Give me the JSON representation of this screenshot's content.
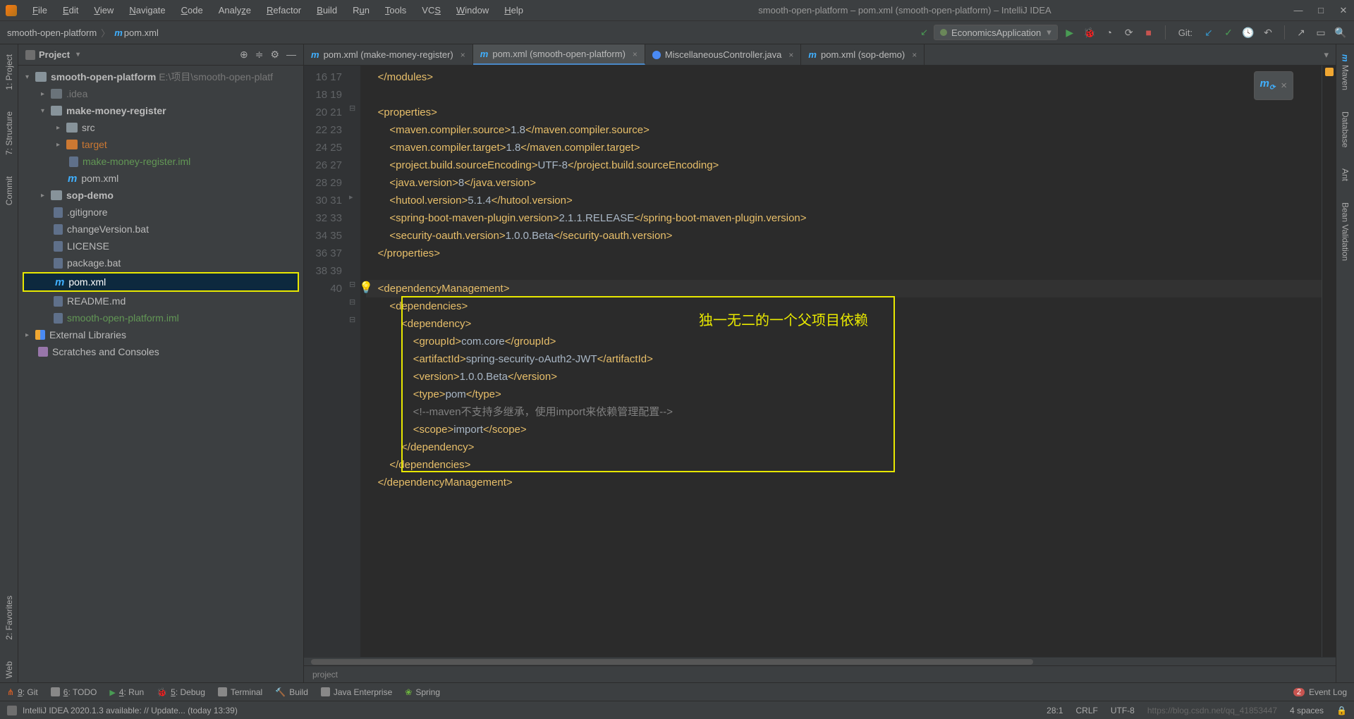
{
  "window": {
    "title": "smooth-open-platform – pom.xml (smooth-open-platform) – IntelliJ IDEA",
    "min_icon": "—",
    "max_icon": "□",
    "close_icon": "✕"
  },
  "menu": [
    "File",
    "Edit",
    "View",
    "Navigate",
    "Code",
    "Analyze",
    "Refactor",
    "Build",
    "Run",
    "Tools",
    "VCS",
    "Window",
    "Help"
  ],
  "breadcrumb": {
    "project": "smooth-open-platform",
    "file": "pom.xml"
  },
  "run_config": {
    "name": "EconomicsApplication"
  },
  "git_label": "Git:",
  "left_gutter": [
    "1: Project",
    "7: Structure",
    "Commit",
    "2: Favorites",
    "Web"
  ],
  "right_gutter": [
    "Maven",
    "Database",
    "Ant",
    "Bean Validation"
  ],
  "project_panel": {
    "title": "Project",
    "tree": {
      "root": {
        "name": "smooth-open-platform",
        "path": "E:\\项目\\smooth-open-platf"
      },
      "idea": ".idea",
      "mmr": "make-money-register",
      "src": "src",
      "target": "target",
      "mmr_iml": "make-money-register.iml",
      "mmr_pom": "pom.xml",
      "sop": "sop-demo",
      "gitignore": ".gitignore",
      "changeVersion": "changeVersion.bat",
      "license": "LICENSE",
      "package": "package.bat",
      "root_pom": "pom.xml",
      "readme": "README.md",
      "root_iml": "smooth-open-platform.iml",
      "ext": "External Libraries",
      "scratch": "Scratches and Consoles"
    }
  },
  "tabs": [
    {
      "label": "pom.xml (make-money-register)",
      "icon": "m",
      "active": false
    },
    {
      "label": "pom.xml (smooth-open-platform)",
      "icon": "m",
      "active": true
    },
    {
      "label": "MiscellaneousController.java",
      "icon": "j",
      "active": false
    },
    {
      "label": "pom.xml (sop-demo)",
      "icon": "m",
      "active": false
    }
  ],
  "editor": {
    "line_start": 16,
    "line_end": 40,
    "annotation": "独一无二的一个父项目依赖",
    "lines": {
      "16": "    </modules>",
      "17": "",
      "18": "    <properties>",
      "19": "        <maven.compiler.source>1.8</maven.compiler.source>",
      "20": "        <maven.compiler.target>1.8</maven.compiler.target>",
      "21": "        <project.build.sourceEncoding>UTF-8</project.build.sourceEncoding>",
      "22": "        <java.version>8</java.version>",
      "23": "        <hutool.version>5.1.4</hutool.version>",
      "24": "        <spring-boot-maven-plugin.version>2.1.1.RELEASE</spring-boot-maven-plugin.version>",
      "25": "        <security-oauth.version>1.0.0.Beta</security-oauth.version>",
      "26": "    </properties>",
      "27": "",
      "28": "    <dependencyManagement>",
      "29": "        <dependencies>",
      "30": "            <dependency>",
      "31": "                <groupId>com.core</groupId>",
      "32": "                <artifactId>spring-security-oAuth2-JWT</artifactId>",
      "33": "                <version>1.0.0.Beta</version>",
      "34": "                <type>pom</type>",
      "35": "                <!--maven不支持多继承，使用import来依赖管理配置-->",
      "36": "                <scope>import</scope>",
      "37": "            </dependency>",
      "38": "        </dependencies>",
      "39": "    </dependencyManagement>",
      "40": ""
    },
    "crumb": "project"
  },
  "bottom_tools": {
    "git": "9: Git",
    "todo": "6: TODO",
    "run": "4: Run",
    "debug": "5: Debug",
    "terminal": "Terminal",
    "build": "Build",
    "jee": "Java Enterprise",
    "spring": "Spring",
    "event_log": "Event Log",
    "event_badge": "2"
  },
  "statusbar": {
    "msg": "IntelliJ IDEA 2020.1.3 available: // Update... (today 13:39)",
    "pos": "28:1",
    "eol": "CRLF",
    "enc": "UTF-8",
    "indent": "4 spaces",
    "watermark": "https://blog.csdn.net/qq_41853447"
  }
}
